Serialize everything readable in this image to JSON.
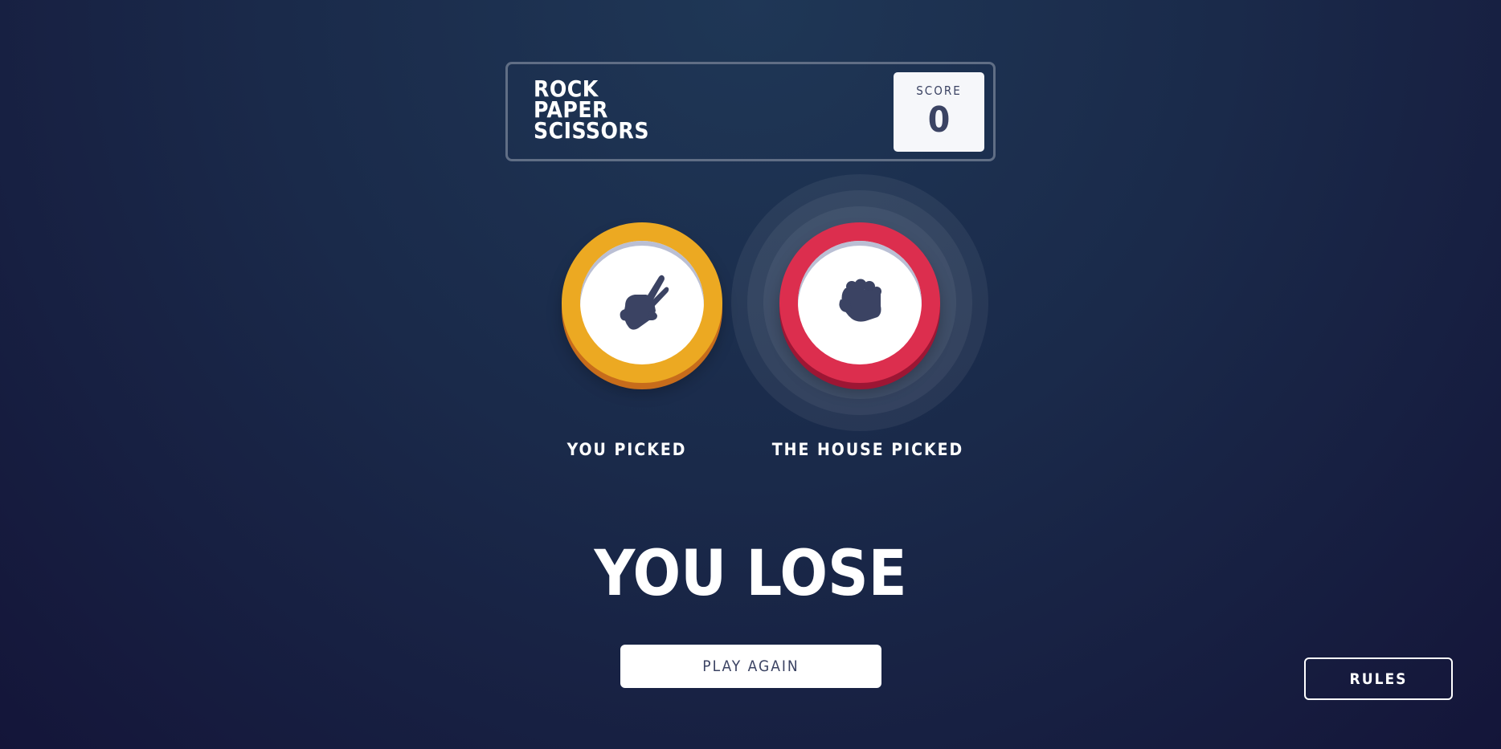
{
  "header": {
    "logo_lines": [
      "ROCK",
      "PAPER",
      "SCISSORS"
    ],
    "score_label": "SCORE",
    "score_value": "0"
  },
  "player": {
    "choice": "scissors",
    "icon": "scissors-hand-icon",
    "ring_color": "#eca922",
    "label": "YOU PICKED"
  },
  "house": {
    "choice": "rock",
    "icon": "rock-fist-icon",
    "ring_color": "#dc2e4e",
    "label": "THE HOUSE PICKED",
    "winner_highlight": true
  },
  "result": {
    "text": "YOU LOSE",
    "play_again_label": "PLAY AGAIN"
  },
  "rules_label": "RULES",
  "colors": {
    "text_dark": "#3b4363",
    "header_outline": "#606e85",
    "background_top": "#1f3756",
    "background_bottom": "#141539"
  }
}
